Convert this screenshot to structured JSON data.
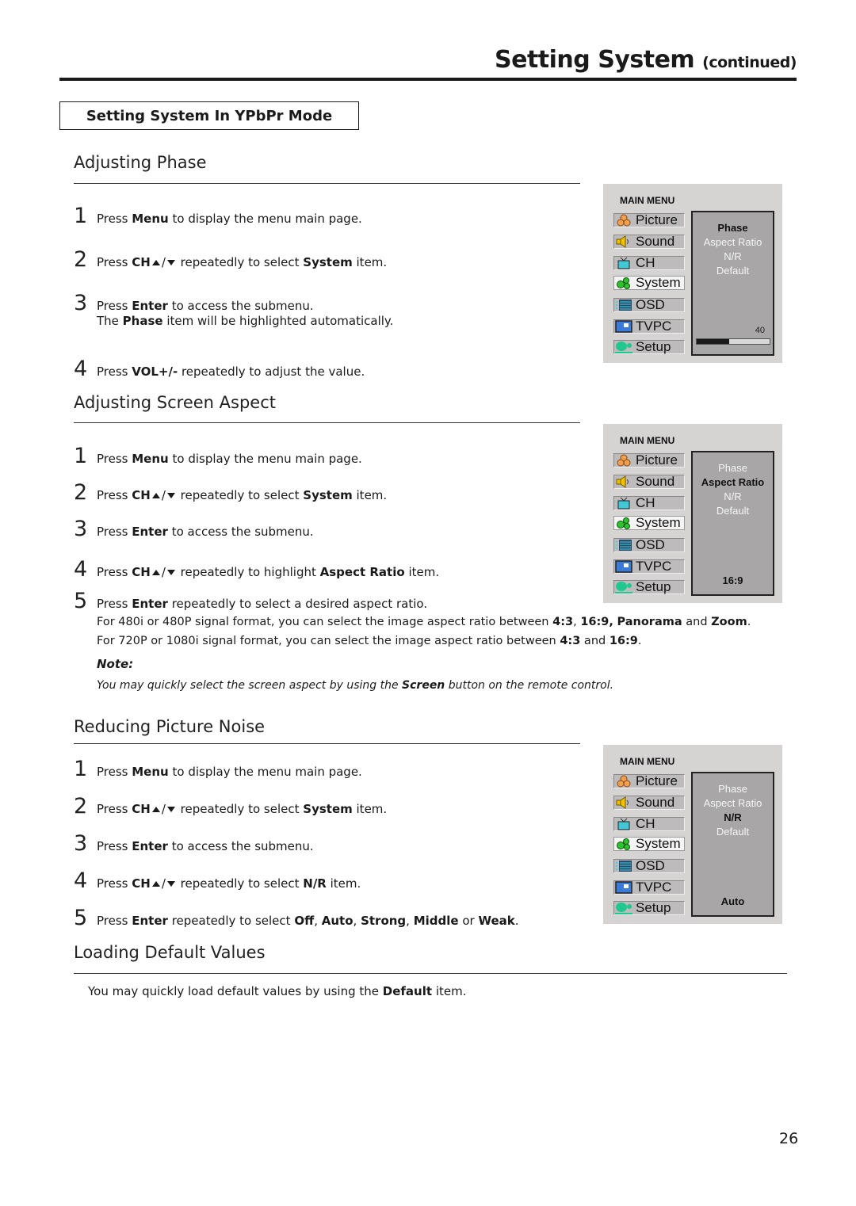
{
  "header": {
    "title": "Setting System",
    "title_suffix": "(continued)",
    "mode_box": "Setting System In YPbPr Mode"
  },
  "sections": [
    {
      "title": "Adjusting Phase",
      "steps": [
        {
          "num": "1",
          "parts": [
            "Press ",
            "Menu",
            " to display the menu main page."
          ]
        },
        {
          "num": "2",
          "parts": [
            "Press ",
            "CH",
            " repeatedly to select ",
            "System",
            " item."
          ]
        },
        {
          "num": "3",
          "parts": [
            "Press ",
            "Enter",
            " to access the submenu."
          ],
          "sub": [
            "The ",
            "Phase",
            "  item will be highlighted automatically."
          ]
        },
        {
          "num": "4",
          "parts": [
            "Press ",
            "VOL+/-",
            " repeatedly to adjust the value."
          ]
        }
      ]
    },
    {
      "title": "Adjusting Screen Aspect",
      "steps": [
        {
          "num": "1",
          "parts": [
            "Press ",
            "Menu",
            " to display the menu main page."
          ]
        },
        {
          "num": "2",
          "parts": [
            "Press ",
            "CH",
            " repeatedly to select ",
            "System",
            " item."
          ]
        },
        {
          "num": "3",
          "parts": [
            "Press ",
            "Enter",
            " to access the submenu."
          ]
        },
        {
          "num": "4",
          "parts": [
            "Press ",
            "CH",
            " repeatedly to highlight ",
            "Aspect Ratio",
            " item."
          ]
        },
        {
          "num": "5",
          "parts": [
            "Press ",
            "Enter",
            " repeatedly to select a desired aspect ratio."
          ]
        }
      ],
      "extra": [
        [
          "For 480i or 480P signal format, you can select the image aspect ratio between ",
          "4:3",
          ", ",
          "16:9,",
          " ",
          "Panorama",
          " and ",
          "Zoom",
          "."
        ],
        [
          "For 720P or 1080i signal format, you can select the image aspect ratio between ",
          "4:3",
          " and ",
          "16:9",
          "."
        ]
      ],
      "note_heading": "Note:",
      "note_text": [
        "You may quickly select the screen aspect by using the ",
        "Screen",
        " button on the remote control."
      ]
    },
    {
      "title": "Reducing Picture Noise",
      "steps": [
        {
          "num": "1",
          "parts": [
            "Press ",
            "Menu",
            " to display the menu main page."
          ]
        },
        {
          "num": "2",
          "parts": [
            "Press ",
            "CH",
            " repeatedly to select ",
            "System",
            " item."
          ]
        },
        {
          "num": "3",
          "parts": [
            "Press ",
            "Enter",
            " to access the submenu."
          ]
        },
        {
          "num": "4",
          "parts": [
            "Press ",
            "CH",
            " repeatedly to select ",
            "N/R",
            " item."
          ]
        },
        {
          "num": "5",
          "parts": [
            "Press ",
            "Enter",
            " repeatedly to select ",
            "Off",
            ", ",
            "Auto",
            ", ",
            "Strong",
            ", ",
            "Middle",
            " or ",
            "Weak",
            "."
          ]
        }
      ]
    },
    {
      "title": "Loading Default Values",
      "text": [
        "You may quickly load default values  by using the ",
        "Default",
        " item."
      ]
    }
  ],
  "osd_menus": [
    {
      "heading": "MAIN MENU",
      "items": [
        "Picture",
        "Sound",
        "CH",
        "System",
        "OSD",
        "TVPC",
        "Setup"
      ],
      "selected_item": "System",
      "options": [
        "Phase",
        "Aspect Ratio",
        "N/R",
        "Default"
      ],
      "highlighted_option": "Phase",
      "value": "40",
      "progress_fraction": 0.45
    },
    {
      "heading": "MAIN MENU",
      "items": [
        "Picture",
        "Sound",
        "CH",
        "System",
        "OSD",
        "TVPC",
        "Setup"
      ],
      "selected_item": "System",
      "options": [
        "Phase",
        "Aspect Ratio",
        "N/R",
        "Default"
      ],
      "highlighted_option": "Aspect Ratio",
      "value": "16:9"
    },
    {
      "heading": "MAIN MENU",
      "items": [
        "Picture",
        "Sound",
        "CH",
        "System",
        "OSD",
        "TVPC",
        "Setup"
      ],
      "selected_item": "System",
      "options": [
        "Phase",
        "Aspect Ratio",
        "N/R",
        "Default"
      ],
      "highlighted_option": "N/R",
      "value": "Auto"
    }
  ],
  "icons": {
    "Picture": "rgb-circles-icon",
    "Sound": "speaker-icon",
    "CH": "tv-icon",
    "System": "gears-icon",
    "OSD": "list-icon",
    "TVPC": "monitor-icon",
    "Setup": "setup-icon"
  },
  "footer": {
    "page_number": "26"
  }
}
